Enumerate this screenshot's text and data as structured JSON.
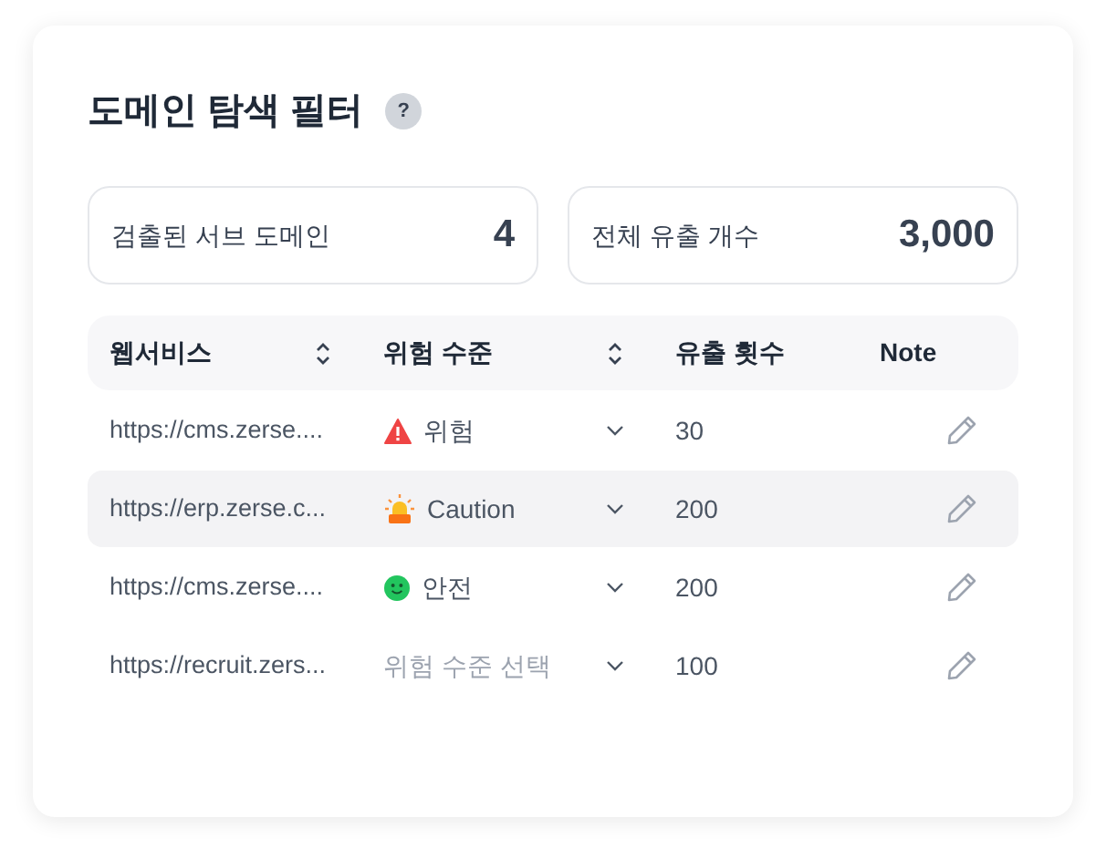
{
  "title": "도메인 탐색 필터",
  "help": "?",
  "stats": [
    {
      "label": "검출된 서브 도메인",
      "value": "4"
    },
    {
      "label": "전체 유출 개수",
      "value": "3,000"
    }
  ],
  "table": {
    "columns": [
      {
        "label": "웹서비스",
        "kind": "sortable"
      },
      {
        "label": "위험 수준",
        "kind": "sortable"
      },
      {
        "label": "유출 횟수",
        "kind": "plain"
      },
      {
        "label": "Note",
        "kind": "plain"
      }
    ],
    "rows": [
      {
        "url": "https://cms.zerse....",
        "risk": {
          "kind": "danger",
          "label": "위험"
        },
        "count": "30",
        "selected": false
      },
      {
        "url": "https://erp.zerse.c...",
        "risk": {
          "kind": "caution",
          "label": "Caution"
        },
        "count": "200",
        "selected": true
      },
      {
        "url": "https://cms.zerse....",
        "risk": {
          "kind": "safe",
          "label": "안전"
        },
        "count": "200",
        "selected": false
      },
      {
        "url": "https://recruit.zers...",
        "risk": {
          "kind": "none",
          "placeholder": "위험 수준 선택"
        },
        "count": "100",
        "selected": false
      }
    ]
  }
}
